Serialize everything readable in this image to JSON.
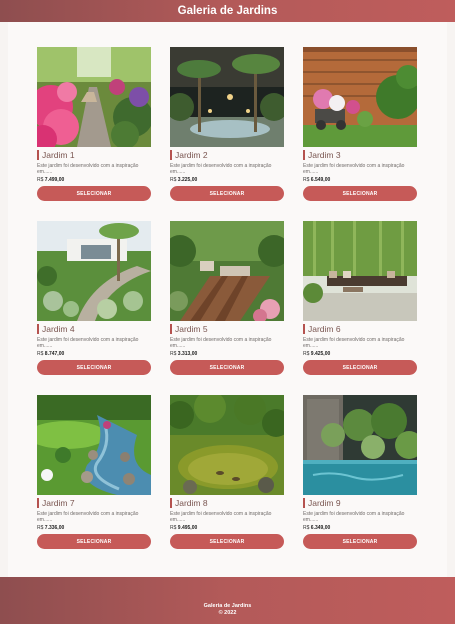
{
  "header": {
    "title": "Galeria de Jardins"
  },
  "gallery": {
    "cards": [
      {
        "title": "Jardim 1",
        "description": "Este jardim foi desenvolvido com a inspiração em......",
        "currency": "R$",
        "price": "7.499,00",
        "button": "SELECIONAR",
        "image": "garden-path-azaleas"
      },
      {
        "title": "Jardim 2",
        "description": "Este jardim foi desenvolvido com a inspiração em......",
        "currency": "R$",
        "price": "3.225,00",
        "button": "SELECIONAR",
        "image": "palm-garden-night"
      },
      {
        "title": "Jardim 3",
        "description": "Este jardim foi desenvolvido com a inspiração em......",
        "currency": "R$",
        "price": "6.549,00",
        "button": "SELECIONAR",
        "image": "patio-flower-cart"
      },
      {
        "title": "Jardim 4",
        "description": "Este jardim foi desenvolvido com a inspiração em......",
        "currency": "R$",
        "price": "8.747,00",
        "button": "SELECIONAR",
        "image": "tropical-lawn-agave"
      },
      {
        "title": "Jardim 5",
        "description": "Este jardim foi desenvolvido com a inspiração em......",
        "currency": "R$",
        "price": "3.313,00",
        "button": "SELECIONAR",
        "image": "wooden-deck-garden"
      },
      {
        "title": "Jardim 6",
        "description": "Este jardim foi desenvolvido com a inspiração em......",
        "currency": "R$",
        "price": "9.425,00",
        "button": "SELECIONAR",
        "image": "bamboo-lounge"
      },
      {
        "title": "Jardim 7",
        "description": "Este jardim foi desenvolvido com a inspiração em......",
        "currency": "R$",
        "price": "7.336,00",
        "button": "SELECIONAR",
        "image": "garden-stream"
      },
      {
        "title": "Jardim 8",
        "description": "Este jardim foi desenvolvido com a inspiração em......",
        "currency": "R$",
        "price": "9.495,00",
        "button": "SELECIONAR",
        "image": "green-pond-ducks"
      },
      {
        "title": "Jardim 9",
        "description": "Este jardim foi desenvolvido com a inspiração em......",
        "currency": "R$",
        "price": "6.349,00",
        "button": "SELECIONAR",
        "image": "pool-tropical-plants"
      }
    ]
  },
  "footer": {
    "line1": "Galeria de Jardins",
    "line2": "© 2022"
  },
  "colors": {
    "accent": "#c65a58",
    "header_gradient_start": "#8e4e4f",
    "header_gradient_end": "#bf5d5c",
    "background": "#f7f4f2"
  }
}
